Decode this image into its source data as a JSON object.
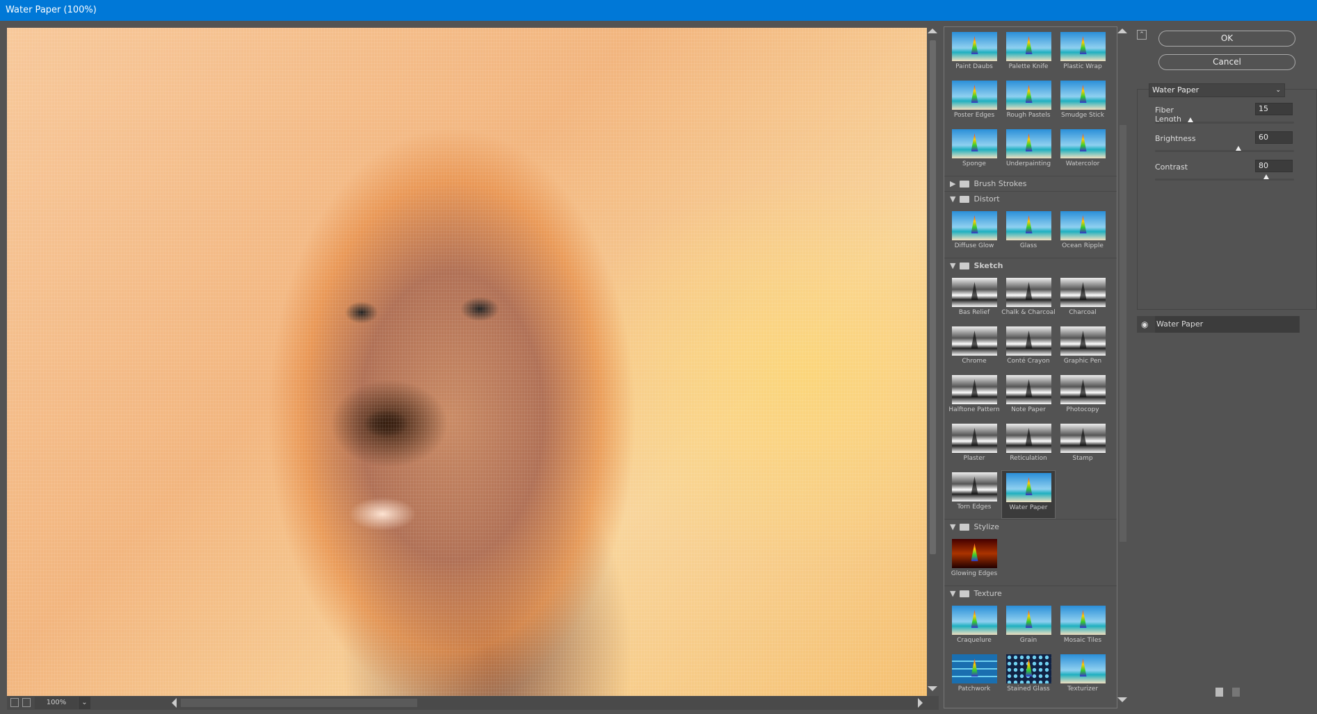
{
  "window": {
    "title": "Water Paper (100%)"
  },
  "preview": {
    "zoom": "100%"
  },
  "gallery": {
    "artistic_items": [
      "Paint Daubs",
      "Palette Knife",
      "Plastic Wrap",
      "Poster Edges",
      "Rough Pastels",
      "Smudge Stick",
      "Sponge",
      "Underpainting",
      "Watercolor"
    ],
    "brush_strokes": {
      "label": "Brush Strokes",
      "expanded": false
    },
    "distort": {
      "label": "Distort",
      "items": [
        "Diffuse Glow",
        "Glass",
        "Ocean Ripple"
      ]
    },
    "sketch": {
      "label": "Sketch",
      "items": [
        "Bas Relief",
        "Chalk & Charcoal",
        "Charcoal",
        "Chrome",
        "Conté Crayon",
        "Graphic Pen",
        "Halftone Pattern",
        "Note Paper",
        "Photocopy",
        "Plaster",
        "Reticulation",
        "Stamp",
        "Torn Edges",
        "Water Paper"
      ],
      "selected": "Water Paper"
    },
    "stylize": {
      "label": "Stylize",
      "items": [
        "Glowing Edges"
      ]
    },
    "texture": {
      "label": "Texture",
      "items": [
        "Craquelure",
        "Grain",
        "Mosaic Tiles",
        "Patchwork",
        "Stained Glass",
        "Texturizer"
      ]
    }
  },
  "buttons": {
    "ok": "OK",
    "cancel": "Cancel"
  },
  "settings": {
    "filter": "Water Paper",
    "params": [
      {
        "label": "Fiber Length",
        "value": "15",
        "min": 3,
        "max": 50
      },
      {
        "label": "Brightness",
        "value": "60",
        "min": 0,
        "max": 100
      },
      {
        "label": "Contrast",
        "value": "80",
        "min": 0,
        "max": 100
      }
    ]
  },
  "layers": [
    {
      "name": "Water Paper",
      "visible": true
    }
  ]
}
